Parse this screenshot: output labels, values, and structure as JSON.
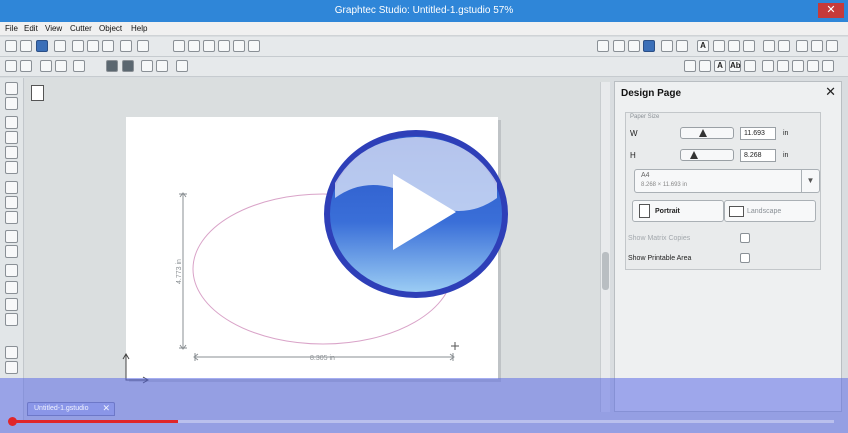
{
  "window": {
    "title": "Graphtec Studio: Untitled-1.gstudio 57%",
    "close_glyph": "✕"
  },
  "menu": [
    "File",
    "Edit",
    "View",
    "Cutter",
    "Object",
    "Help"
  ],
  "toolbar1": [
    "new-icon",
    "open-icon",
    "save-icon",
    "print-icon",
    "cut-icon",
    "copy-icon",
    "paste-icon",
    "undo-icon",
    "redo-icon",
    "pan-icon",
    "zoom-in-icon",
    "zoom-out-icon",
    "zoom-fit-icon",
    "zoom-page-icon",
    "zoom-selection-icon"
  ],
  "toolbar1_right": [
    "fill-icon",
    "window-icon",
    "grid-icon",
    "shape-icon",
    "line-style-icon",
    "lines-icon",
    "text-icon",
    "node-icon",
    "rotate-icon",
    "replicate-icon",
    "mirror-icon",
    "offset-icon",
    "rectangle-icon",
    "image-icon",
    "select-icon"
  ],
  "toolbar2": [
    "select-icon",
    "group-icon",
    "ungroup-icon",
    "bring-front-icon",
    "send-back-icon",
    "rotate-icon",
    "align-icon",
    "lock-icon"
  ],
  "toolbar2_right": [
    "page-icon",
    "grid-icon",
    "text-a-icon",
    "text-ab-icon",
    "transform-icon",
    "align-icon",
    "layers-icon",
    "library-icon"
  ],
  "canvas": {
    "width_dimension": "8.305 in",
    "height_dimension": "4.773 in"
  },
  "design_page": {
    "title": "Design Page",
    "close_glyph": "✕",
    "paper_size_label": "Paper Size",
    "width": {
      "label": "W",
      "value": "11.693",
      "unit": "in"
    },
    "height": {
      "label": "H",
      "value": "8.268",
      "unit": "in"
    },
    "paper": {
      "name": "A4",
      "dims": "8.268 × 11.693 in"
    },
    "orientation": {
      "portrait": "Portrait",
      "landscape": "Landscape",
      "selected": "Portrait"
    },
    "show_matrix_copies": {
      "label": "Show Matrix Copies",
      "checked": false
    },
    "show_printable_area": {
      "label": "Show Printable Area",
      "checked": false
    }
  },
  "document_tab": {
    "label": "Untitled-1.gstudio",
    "close_glyph": "✕"
  },
  "video": {
    "progress": 0.2
  },
  "colors": {
    "titlebar": "#2f86d8",
    "panel_bg": "#eef0f1",
    "progress": "#e0262a",
    "play_blue": "#3a6fd8",
    "ellipse": "#d9a3c8"
  }
}
